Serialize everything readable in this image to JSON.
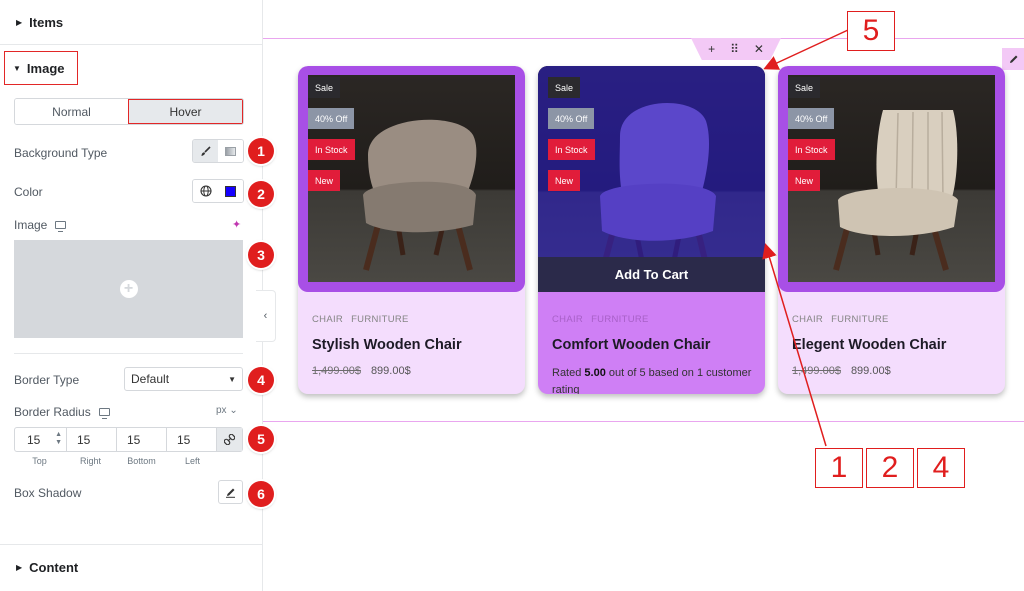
{
  "panel": {
    "sections": {
      "items": "Items",
      "image": "Image",
      "content": "Content"
    },
    "tabs": {
      "normal": "Normal",
      "hover": "Hover"
    },
    "background_type_label": "Background Type",
    "color_label": "Color",
    "color_value": "#1400ff",
    "image_label": "Image",
    "border_type_label": "Border Type",
    "border_type_value": "Default",
    "border_radius_label": "Border Radius",
    "units": "px",
    "radius": {
      "values": [
        "15",
        "15",
        "15",
        "15"
      ],
      "labels": [
        "Top",
        "Right",
        "Bottom",
        "Left"
      ]
    },
    "box_shadow_label": "Box Shadow",
    "badges": [
      "1",
      "2",
      "3",
      "4",
      "5",
      "6"
    ]
  },
  "products": [
    {
      "badges": [
        "Sale",
        "40% Off",
        "In Stock",
        "New"
      ],
      "categories": [
        "CHAIR",
        "FURNITURE"
      ],
      "title": "Stylish Wooden Chair",
      "old_price": "1,499.00$",
      "price": "899.00$",
      "chair_color": "#9a8d82"
    },
    {
      "badges": [
        "Sale",
        "40% Off",
        "In Stock",
        "New"
      ],
      "categories": [
        "CHAIR",
        "FURNITURE"
      ],
      "title": "Comfort Wooden Chair",
      "rating_prefix": "Rated",
      "rating_value": "5.00",
      "rating_suffix": "out of 5 based on 1 customer rating",
      "cart_label": "Add To Cart",
      "chair_color": "#9a7ec0"
    },
    {
      "badges": [
        "Sale",
        "40% Off",
        "In Stock",
        "New"
      ],
      "categories": [
        "CHAIR",
        "FURNITURE"
      ],
      "title": "Elegent Wooden Chair",
      "old_price": "1,499.00$",
      "price": "899.00$",
      "chair_color": "#d9cfbf"
    }
  ],
  "annotations": {
    "box_5": "5",
    "box_1": "1",
    "box_2": "2",
    "box_4": "4"
  },
  "colors": {
    "accent_red": "#e01e1e",
    "card_frame": "#a84fe6",
    "card_bg": "#f4ddfd",
    "hover_overlay": "#2818d2"
  }
}
